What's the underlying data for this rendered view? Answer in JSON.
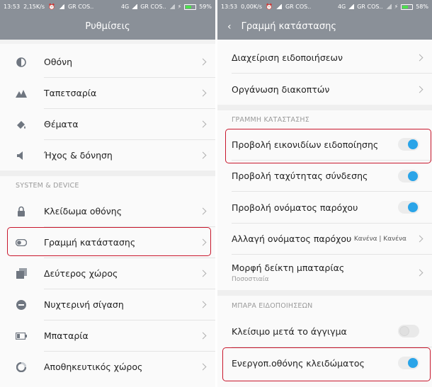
{
  "left": {
    "statusbar": {
      "time": "13:53",
      "speed": "2,15K/s",
      "carrier1": "GR COS..",
      "net": "4G",
      "carrier2": "GR COS..",
      "battery": "59%"
    },
    "title": "Ρυθμίσεις",
    "items": [
      {
        "label": "Οθόνη",
        "icon": "display-icon"
      },
      {
        "label": "Ταπετσαρία",
        "icon": "wallpaper-icon"
      },
      {
        "label": "Θέματα",
        "icon": "themes-icon"
      },
      {
        "label": "Ήχος & δόνηση",
        "icon": "sound-icon"
      }
    ],
    "section_header": "SYSTEM & DEVICE",
    "items2": [
      {
        "label": "Κλείδωμα οθόνης",
        "icon": "lock-icon"
      },
      {
        "label": "Γραμμή κατάστασης",
        "icon": "statusbar-toggle-icon"
      },
      {
        "label": "Δεύτερος χώρος",
        "icon": "second-space-icon"
      },
      {
        "label": "Νυχτερινή σίγαση",
        "icon": "do-not-disturb-icon"
      },
      {
        "label": "Μπαταρία",
        "icon": "battery-icon"
      },
      {
        "label": "Αποθηκευτικός χώρος",
        "icon": "storage-icon"
      }
    ]
  },
  "right": {
    "statusbar": {
      "time": "13:53",
      "speed": "0,00K/s",
      "carrier1": "GR COS..",
      "net": "4G",
      "carrier2": "GR COS..",
      "battery": "58%"
    },
    "title": "Γραμμή κατάστασης",
    "items_top": [
      {
        "label": "Διαχείριση ειδοποιήσεων"
      },
      {
        "label": "Οργάνωση διακοπτών"
      }
    ],
    "section1": "ΓΡΑΜΜΗ ΚΑΤΑΣΤΑΣΗΣ",
    "toggles1": [
      {
        "label": "Προβολή εικονιδίων ειδοποίησης",
        "on": true
      },
      {
        "label": "Προβολή ταχύτητας σύνδεσης",
        "on": true
      },
      {
        "label": "Προβολή ονόματος παρόχου",
        "on": true
      }
    ],
    "carrier_name": {
      "label": "Αλλαγή ονόματος παρόχου",
      "value": "Κανένα | Κανένα"
    },
    "battery_indicator": {
      "label": "Μορφή δείκτη μπαταρίας",
      "value": "Ποσοστιαία"
    },
    "section2": "ΜΠΑΡΑ ΕΙΔΟΠΟΙΗΣΕΩΝ",
    "toggles2": [
      {
        "label": "Κλείσιμο μετά το άγγιγμα",
        "on": false
      },
      {
        "label": "Ενεργοπ.οθόνης κλειδώματος",
        "on": true
      }
    ]
  },
  "colors": {
    "bar": "#8a9098",
    "accent": "#2aa4e8",
    "highlight": "#c8172c"
  }
}
